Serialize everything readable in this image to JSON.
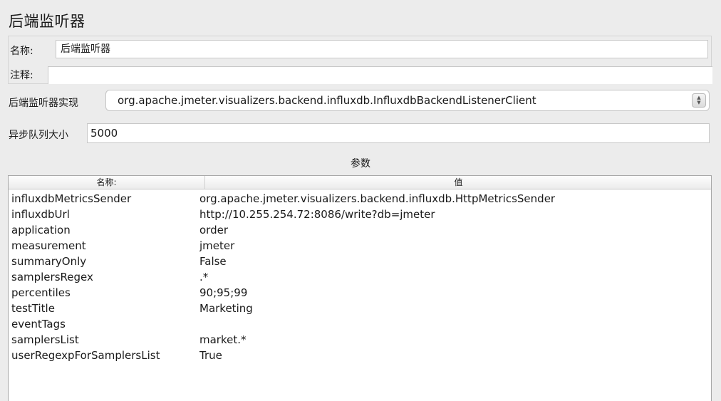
{
  "title": "后端监听器",
  "name_label": "名称:",
  "name_value": "后端监听器",
  "comment_label": "注释:",
  "comment_value": "",
  "impl_label": "后端监听器实现",
  "impl_value": "org.apache.jmeter.visualizers.backend.influxdb.InfluxdbBackendListenerClient",
  "queue_label": "异步队列大小",
  "queue_value": "5000",
  "params_title": "参数",
  "table": {
    "headers": [
      "名称:",
      "值"
    ],
    "rows": [
      {
        "name": "influxdbMetricsSender",
        "value": "org.apache.jmeter.visualizers.backend.influxdb.HttpMetricsSender"
      },
      {
        "name": "influxdbUrl",
        "value": "http://10.255.254.72:8086/write?db=jmeter"
      },
      {
        "name": "application",
        "value": "order"
      },
      {
        "name": "measurement",
        "value": "jmeter"
      },
      {
        "name": "summaryOnly",
        "value": "False"
      },
      {
        "name": "samplersRegex",
        "value": ".*"
      },
      {
        "name": "percentiles",
        "value": "90;95;99"
      },
      {
        "name": "testTitle",
        "value": "Marketing"
      },
      {
        "name": "eventTags",
        "value": ""
      },
      {
        "name": "samplersList",
        "value": "market.*"
      },
      {
        "name": "userRegexpForSamplersList",
        "value": "True"
      }
    ]
  }
}
